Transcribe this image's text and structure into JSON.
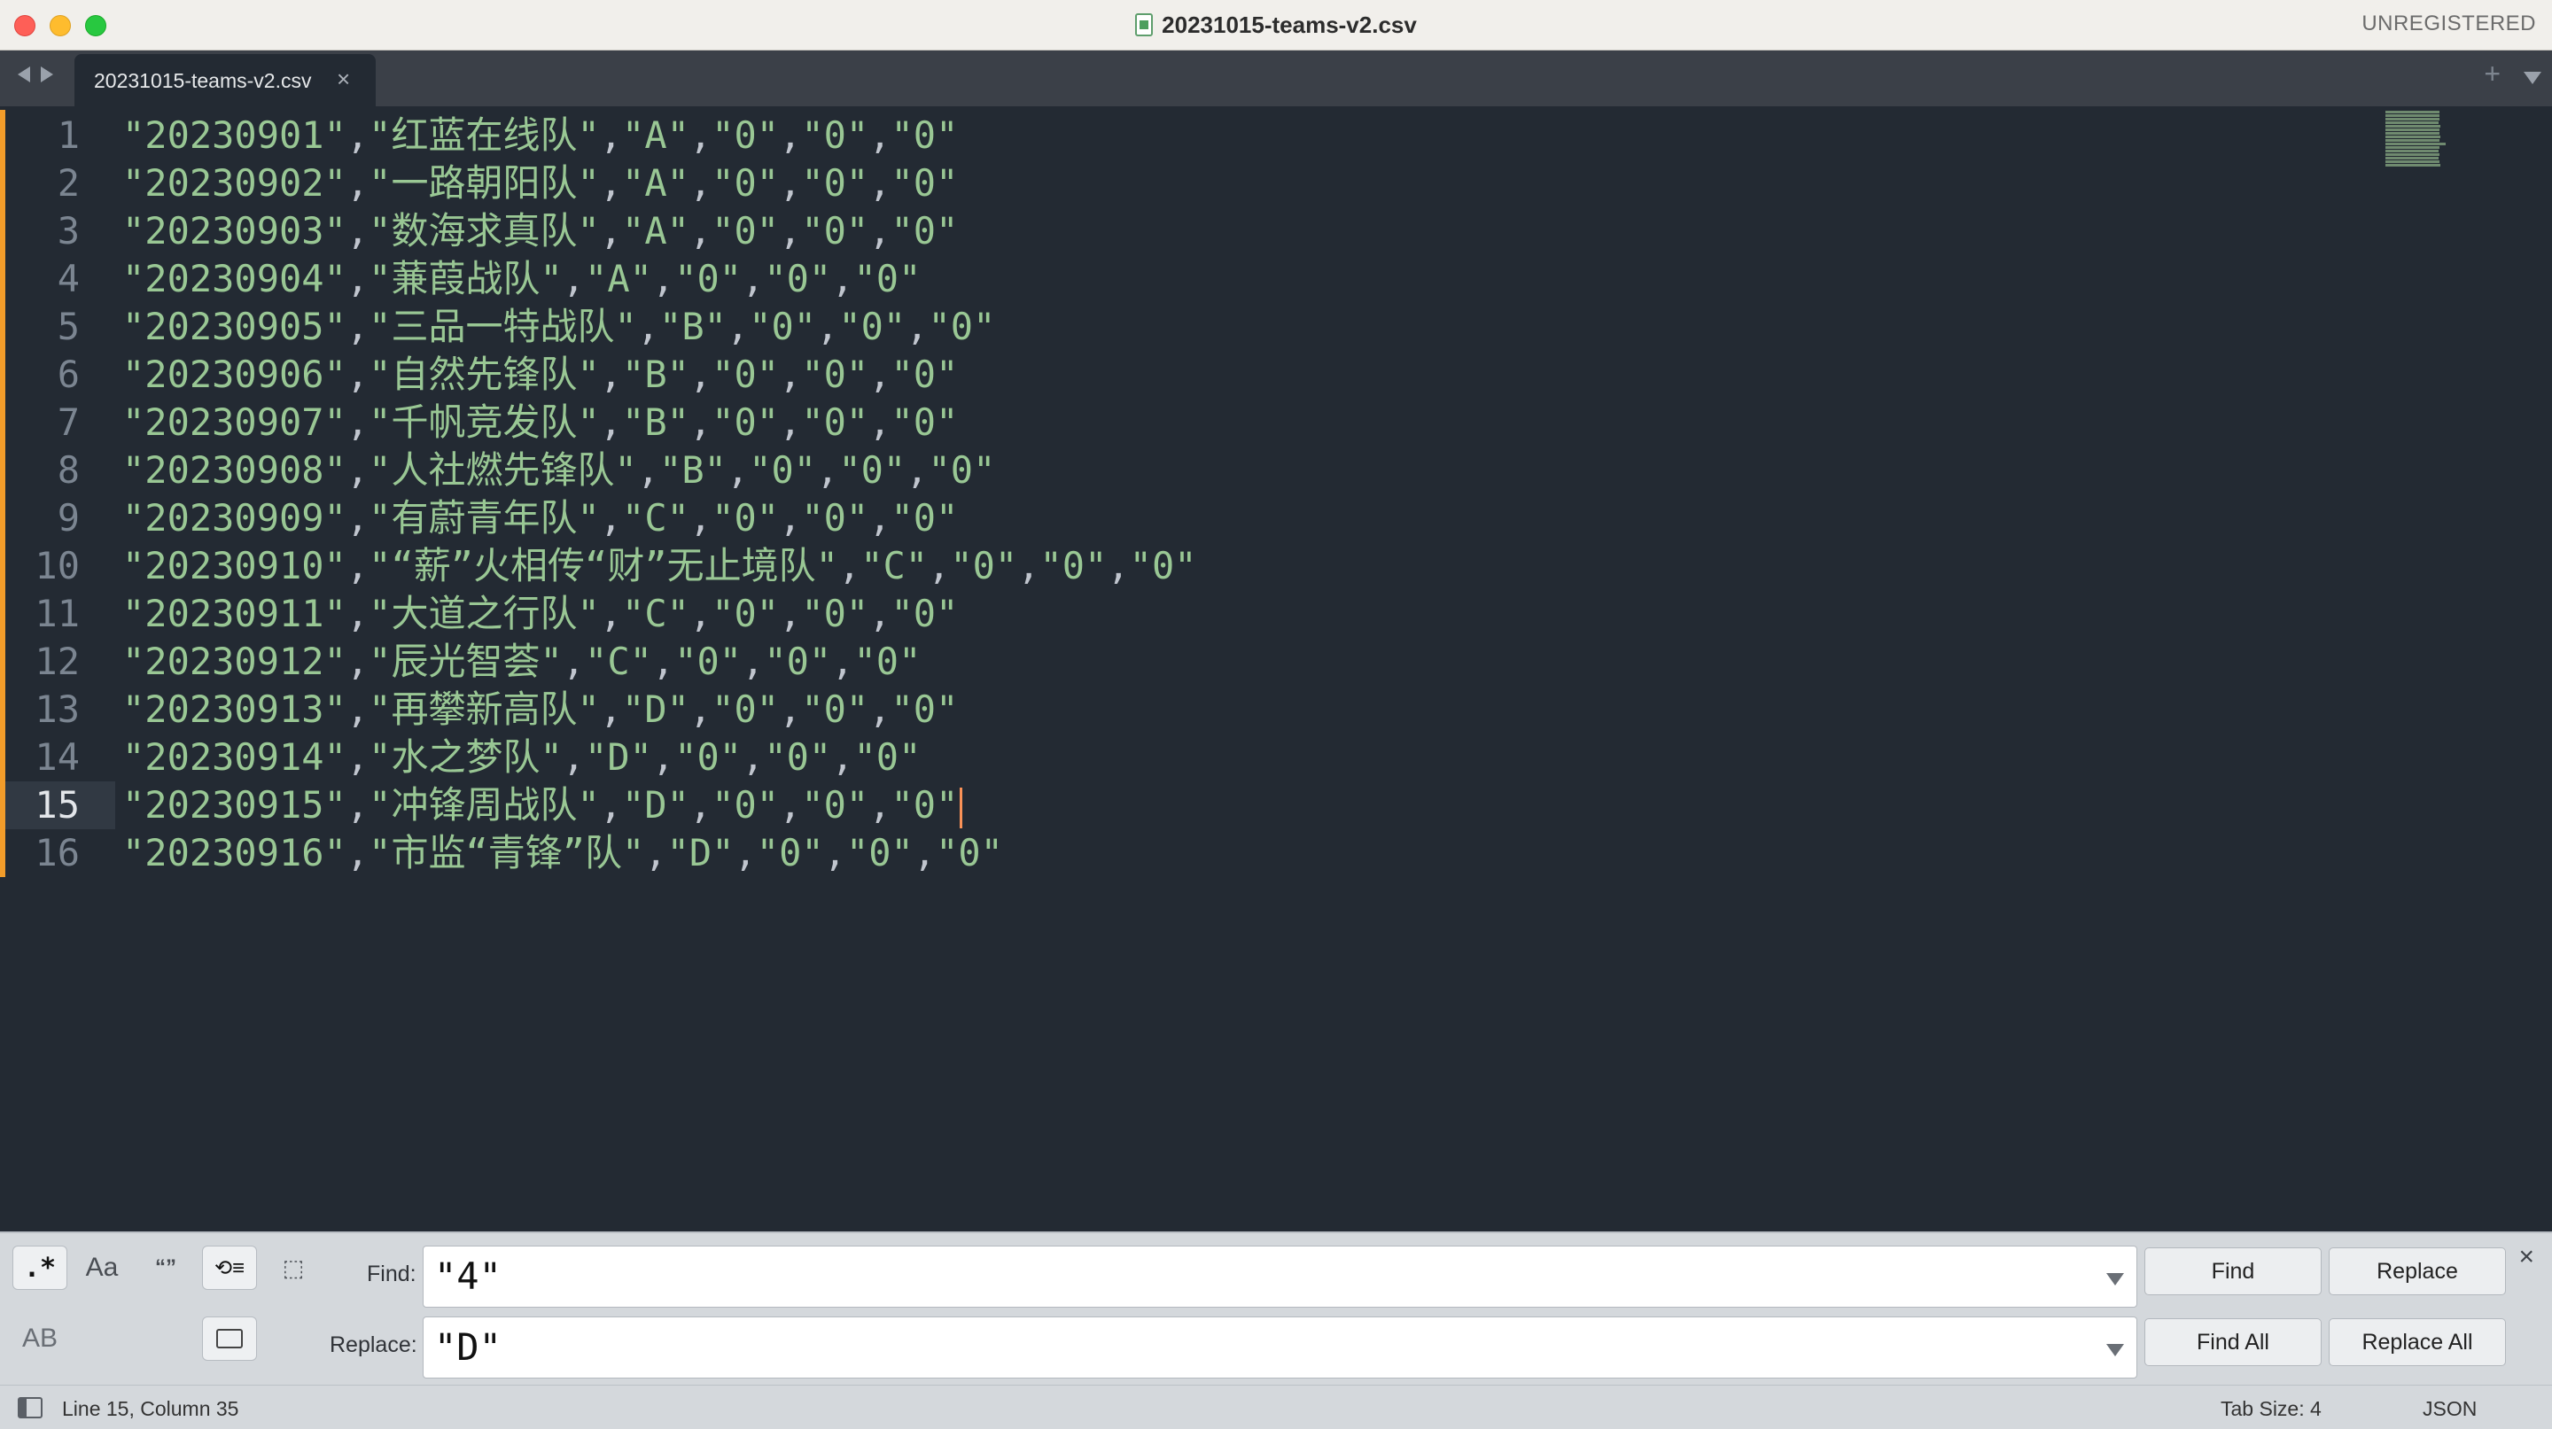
{
  "window": {
    "title": "20231015-teams-v2.csv",
    "license": "UNREGISTERED"
  },
  "tabs": [
    {
      "label": "20231015-teams-v2.csv",
      "close": "×"
    }
  ],
  "tabbar": {
    "new_tab": "+"
  },
  "editor": {
    "current_line": 15,
    "lines": [
      {
        "n": "1",
        "cells": [
          "\"20230901\"",
          "\"红蓝在线队\"",
          "\"A\"",
          "\"0\"",
          "\"0\"",
          "\"0\""
        ]
      },
      {
        "n": "2",
        "cells": [
          "\"20230902\"",
          "\"一路朝阳队\"",
          "\"A\"",
          "\"0\"",
          "\"0\"",
          "\"0\""
        ]
      },
      {
        "n": "3",
        "cells": [
          "\"20230903\"",
          "\"数海求真队\"",
          "\"A\"",
          "\"0\"",
          "\"0\"",
          "\"0\""
        ]
      },
      {
        "n": "4",
        "cells": [
          "\"20230904\"",
          "\"蒹葭战队\"",
          "\"A\"",
          "\"0\"",
          "\"0\"",
          "\"0\""
        ]
      },
      {
        "n": "5",
        "cells": [
          "\"20230905\"",
          "\"三品一特战队\"",
          "\"B\"",
          "\"0\"",
          "\"0\"",
          "\"0\""
        ]
      },
      {
        "n": "6",
        "cells": [
          "\"20230906\"",
          "\"自然先锋队\"",
          "\"B\"",
          "\"0\"",
          "\"0\"",
          "\"0\""
        ]
      },
      {
        "n": "7",
        "cells": [
          "\"20230907\"",
          "\"千帆竞发队\"",
          "\"B\"",
          "\"0\"",
          "\"0\"",
          "\"0\""
        ]
      },
      {
        "n": "8",
        "cells": [
          "\"20230908\"",
          "\"人社燃先锋队\"",
          "\"B\"",
          "\"0\"",
          "\"0\"",
          "\"0\""
        ]
      },
      {
        "n": "9",
        "cells": [
          "\"20230909\"",
          "\"有蔚青年队\"",
          "\"C\"",
          "\"0\"",
          "\"0\"",
          "\"0\""
        ]
      },
      {
        "n": "10",
        "cells": [
          "\"20230910\"",
          "\"“薪”火相传“财”无止境队\"",
          "\"C\"",
          "\"0\"",
          "\"0\"",
          "\"0\""
        ]
      },
      {
        "n": "11",
        "cells": [
          "\"20230911\"",
          "\"大道之行队\"",
          "\"C\"",
          "\"0\"",
          "\"0\"",
          "\"0\""
        ]
      },
      {
        "n": "12",
        "cells": [
          "\"20230912\"",
          "\"辰光智荟\"",
          "\"C\"",
          "\"0\"",
          "\"0\"",
          "\"0\""
        ]
      },
      {
        "n": "13",
        "cells": [
          "\"20230913\"",
          "\"再攀新高队\"",
          "\"D\"",
          "\"0\"",
          "\"0\"",
          "\"0\""
        ]
      },
      {
        "n": "14",
        "cells": [
          "\"20230914\"",
          "\"水之梦队\"",
          "\"D\"",
          "\"0\"",
          "\"0\"",
          "\"0\""
        ]
      },
      {
        "n": "15",
        "cells": [
          "\"20230915\"",
          "\"冲锋周战队\"",
          "\"D\"",
          "\"0\"",
          "\"0\"",
          "\"0\""
        ]
      },
      {
        "n": "16",
        "cells": [
          "\"20230916\"",
          "\"市监“青锋”队\"",
          "\"D\"",
          "\"0\"",
          "\"0\"",
          "\"0\""
        ]
      }
    ]
  },
  "find_panel": {
    "options": {
      "regex": ".*",
      "case": "Aa",
      "whole_word": "“”",
      "wrap": "⟲≡",
      "in_selection": "⬚",
      "preserve_case": "AB"
    },
    "find_label": "Find:",
    "find_value": "\"4\"",
    "replace_label": "Replace:",
    "replace_value": "\"D\"",
    "buttons": {
      "find": "Find",
      "replace": "Replace",
      "find_all": "Find All",
      "replace_all": "Replace All"
    },
    "close": "×"
  },
  "status": {
    "position": "Line 15, Column 35",
    "tab_size": "Tab Size: 4",
    "syntax": "JSON"
  },
  "colors": {
    "editor_bg": "#232a33",
    "string": "#99c794",
    "punctuation": "#c0c5ce",
    "caret": "#f99157",
    "modified_marker": "#f29c2a"
  }
}
